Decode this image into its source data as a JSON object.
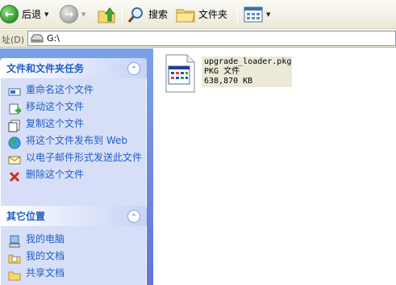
{
  "toolbar": {
    "back_label": "后退",
    "search_label": "搜索",
    "folders_label": "文件夹"
  },
  "address": {
    "label": "址(D)",
    "path": "G:\\"
  },
  "file_tasks": {
    "title": "文件和文件夹任务",
    "items": [
      {
        "label": "重命名这个文件",
        "icon": "rename-icon"
      },
      {
        "label": "移动这个文件",
        "icon": "move-icon"
      },
      {
        "label": "复制这个文件",
        "icon": "copy-icon"
      },
      {
        "label": "将这个文件发布到 Web",
        "icon": "publish-web-icon"
      },
      {
        "label": "以电子邮件形式发送此文件",
        "icon": "email-icon"
      },
      {
        "label": "删除这个文件",
        "icon": "delete-icon"
      }
    ]
  },
  "other_places": {
    "title": "其它位置",
    "items": [
      {
        "label": "我的电脑",
        "icon": "my-computer-icon"
      },
      {
        "label": "我的文档",
        "icon": "my-documents-icon"
      },
      {
        "label": "共享文档",
        "icon": "shared-documents-icon"
      }
    ]
  },
  "file": {
    "name": "upgrade_loader.pkg",
    "type": "PKG 文件",
    "size": "638,870 KB"
  }
}
